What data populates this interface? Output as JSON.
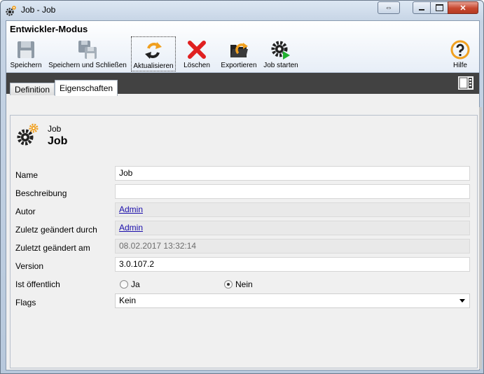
{
  "window": {
    "title": "Job - Job"
  },
  "ribbon": {
    "mode_title": "Entwickler-Modus",
    "tools": [
      {
        "label": "Speichern"
      },
      {
        "label": "Speichern und Schließen"
      },
      {
        "label": "Aktualisieren"
      },
      {
        "label": "Löschen"
      },
      {
        "label": "Exportieren"
      },
      {
        "label": "Job starten"
      },
      {
        "label": "Hilfe"
      }
    ]
  },
  "tabs": [
    {
      "label": "Definition"
    },
    {
      "label": "Eigenschaften"
    }
  ],
  "header": {
    "type": "Job",
    "name": "Job"
  },
  "form": {
    "name": {
      "label": "Name",
      "value": "Job"
    },
    "description": {
      "label": "Beschreibung",
      "value": ""
    },
    "author": {
      "label": "Autor",
      "value": "Admin"
    },
    "modified_by": {
      "label": "Zuletz geändert durch",
      "value": "Admin"
    },
    "modified_at": {
      "label": "Zuletzt geändert am",
      "value": "08.02.2017 13:32:14"
    },
    "version": {
      "label": "Version",
      "value": "3.0.107.2"
    },
    "public": {
      "label": "Ist öffentlich",
      "option_yes": "Ja",
      "option_no": "Nein",
      "selected": "Nein"
    },
    "flags": {
      "label": "Flags",
      "value": "Kein"
    }
  },
  "colors": {
    "accent_orange": "#f0a020",
    "delete_red": "#e02020",
    "dark_bar": "#424242",
    "link": "#1a0dab"
  }
}
